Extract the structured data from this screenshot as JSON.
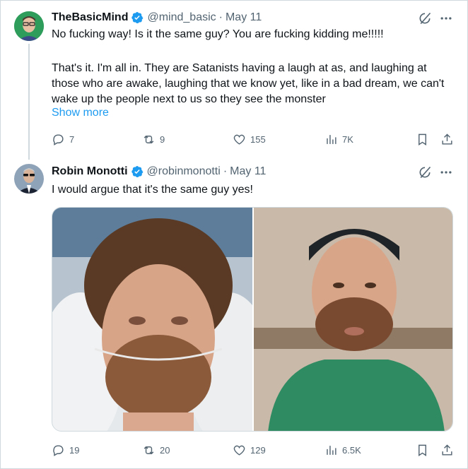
{
  "tweets": [
    {
      "author_name": "TheBasicMind",
      "handle": "@mind_basic",
      "separator": "·",
      "date": "May 11",
      "line1": "No fucking way! Is it the same guy? You are fucking kidding me!!!!!",
      "paragraph": "That's it. I'm all in. They are Satanists having a laugh at as, and laughing at those who are awake, laughing that we know yet, like in a bad dream, we can't wake up the people next to us so they see the monster",
      "show_more": "Show more",
      "replies": "7",
      "reposts": "9",
      "likes": "155",
      "views": "7K"
    },
    {
      "author_name": "Robin Monotti",
      "handle": "@robinmonotti",
      "separator": "·",
      "date": "May 11",
      "line1": "I would argue that it's the same guy yes!",
      "replies": "19",
      "reposts": "20",
      "likes": "129",
      "views": "6.5K"
    }
  ],
  "colors": {
    "text": "#0f1419",
    "secondary": "#536471",
    "link": "#1d9bf0",
    "verified": "#1d9bf0",
    "border": "#cfd9de"
  },
  "icons": [
    "verified-badge-icon",
    "grok-icon",
    "more-icon",
    "reply-icon",
    "repost-icon",
    "like-icon",
    "views-icon",
    "bookmark-icon",
    "share-icon"
  ]
}
